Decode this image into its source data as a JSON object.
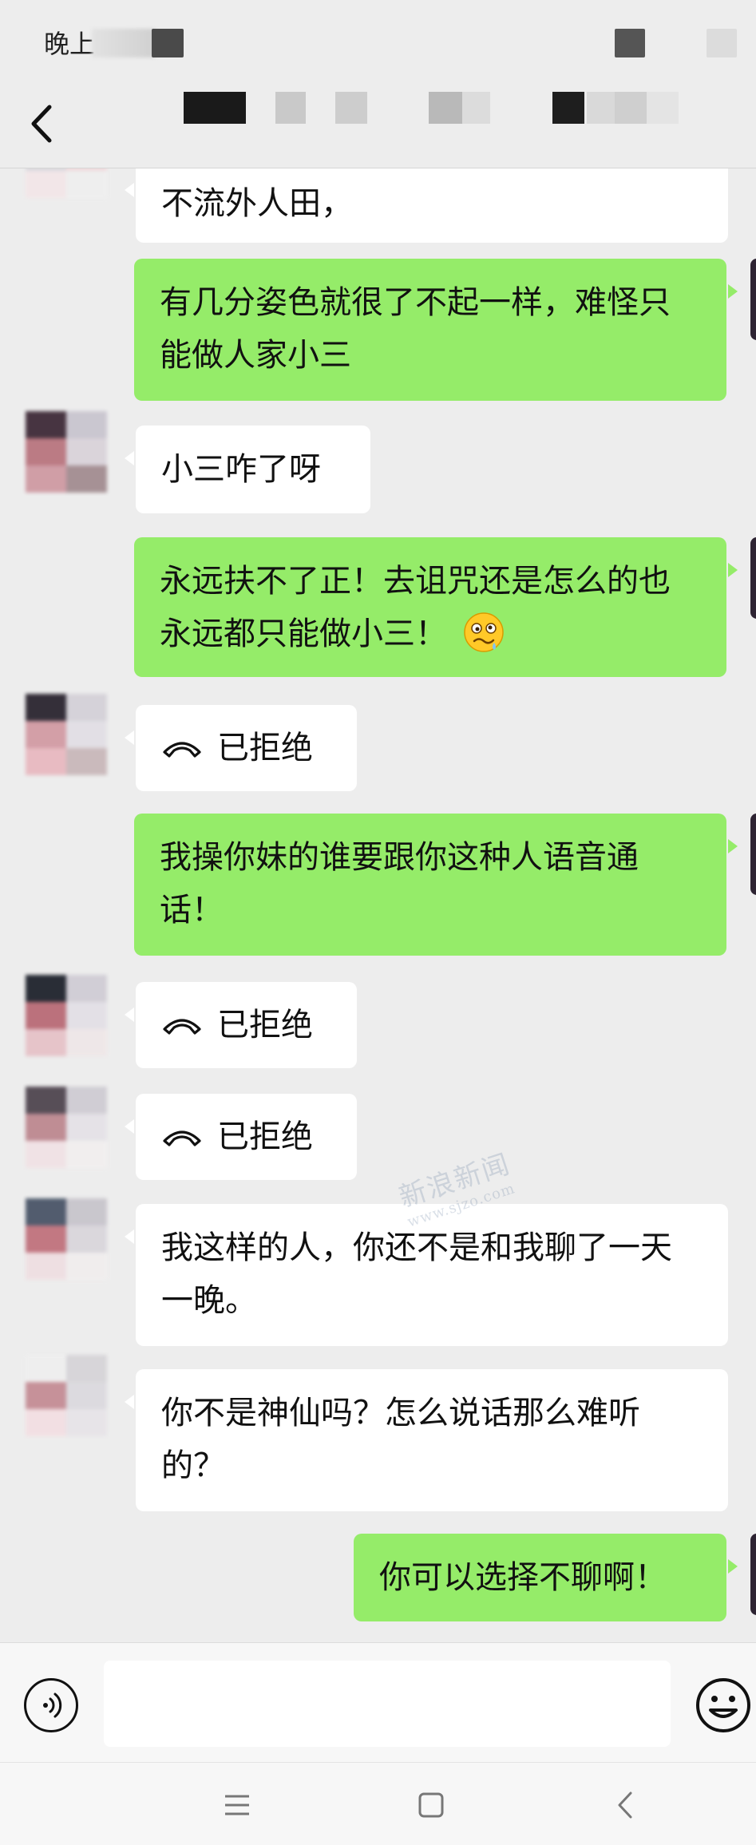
{
  "status_bar": {
    "time": "晚上8"
  },
  "header": {
    "back_icon": "chevron-left-icon"
  },
  "messages": [
    {
      "side": "in",
      "kind": "text",
      "text": "不流外人田，",
      "avatar_colors": [
        "#e3b8bd",
        "#e9c9cc",
        "#d8d8dd",
        "#f0d8db",
        "#f3e6e8",
        "#efefef"
      ]
    },
    {
      "side": "out",
      "kind": "text",
      "text": "有几分姿色就很了不起一样，难怪只能做人家小三"
    },
    {
      "side": "in",
      "kind": "text",
      "text": "小三咋了呀",
      "avatar_colors": [
        "#3f2b38",
        "#c9c5cf",
        "#b9757f",
        "#d9d3da",
        "#cf9aa3",
        "#a38d91"
      ]
    },
    {
      "side": "out",
      "kind": "text",
      "text": "永远扶不了正！去诅咒还是怎么的也永远都只能做小三！",
      "emoji": "woozy-face-emoji"
    },
    {
      "side": "in",
      "kind": "call",
      "icon": "hangup-phone-icon",
      "text": "已拒绝",
      "avatar_colors": [
        "#2b2530",
        "#d4d1d8",
        "#d29ba4",
        "#e2dfe5",
        "#e8b9c0",
        "#c9b8ba"
      ]
    },
    {
      "side": "out",
      "kind": "text",
      "text": "我操你妹的谁要跟你这种人语音通话！"
    },
    {
      "side": "in",
      "kind": "call",
      "icon": "hangup-phone-icon",
      "text": "已拒绝",
      "avatar_colors": [
        "#1f232d",
        "#d0cdd5",
        "#b96b76",
        "#e3e0e6",
        "#e6c2c8",
        "#efe7e8"
      ]
    },
    {
      "side": "in",
      "kind": "call",
      "icon": "hangup-phone-icon",
      "text": "已拒绝",
      "avatar_colors": [
        "#504650",
        "#cfccd3",
        "#bd8890",
        "#e5e2e7",
        "#f1e2e5",
        "#f2efef"
      ]
    },
    {
      "side": "in",
      "kind": "text",
      "text": "我这样的人，你还不是和我聊了一天一晚。",
      "avatar_colors": [
        "#4a5568",
        "#c8c5cc",
        "#c0727d",
        "#d9d6dc",
        "#efdfe2",
        "#f1eeee"
      ]
    },
    {
      "side": "in",
      "kind": "text",
      "text": "你不是神仙吗？怎么说话那么难听的？",
      "avatar_colors": [
        "#efefef",
        "#d6d4d8",
        "#c48d95",
        "#dcdadf",
        "#f3dfe3",
        "#e7e4e8"
      ]
    },
    {
      "side": "out",
      "kind": "text",
      "text": "你可以选择不聊啊！"
    }
  ],
  "watermark": {
    "text": "新浪新闻",
    "url": "www.sjzo.com"
  },
  "input_bar": {
    "voice_icon": "voice-input-icon",
    "placeholder": "",
    "emoji_icon": "smiley-face-icon"
  },
  "nav_bar": {
    "icons": [
      "menu-lines-icon",
      "home-square-icon",
      "back-triangle-icon"
    ]
  },
  "colors": {
    "background": "#ededed",
    "outgoing_bubble": "#95ec69",
    "incoming_bubble": "#ffffff"
  }
}
